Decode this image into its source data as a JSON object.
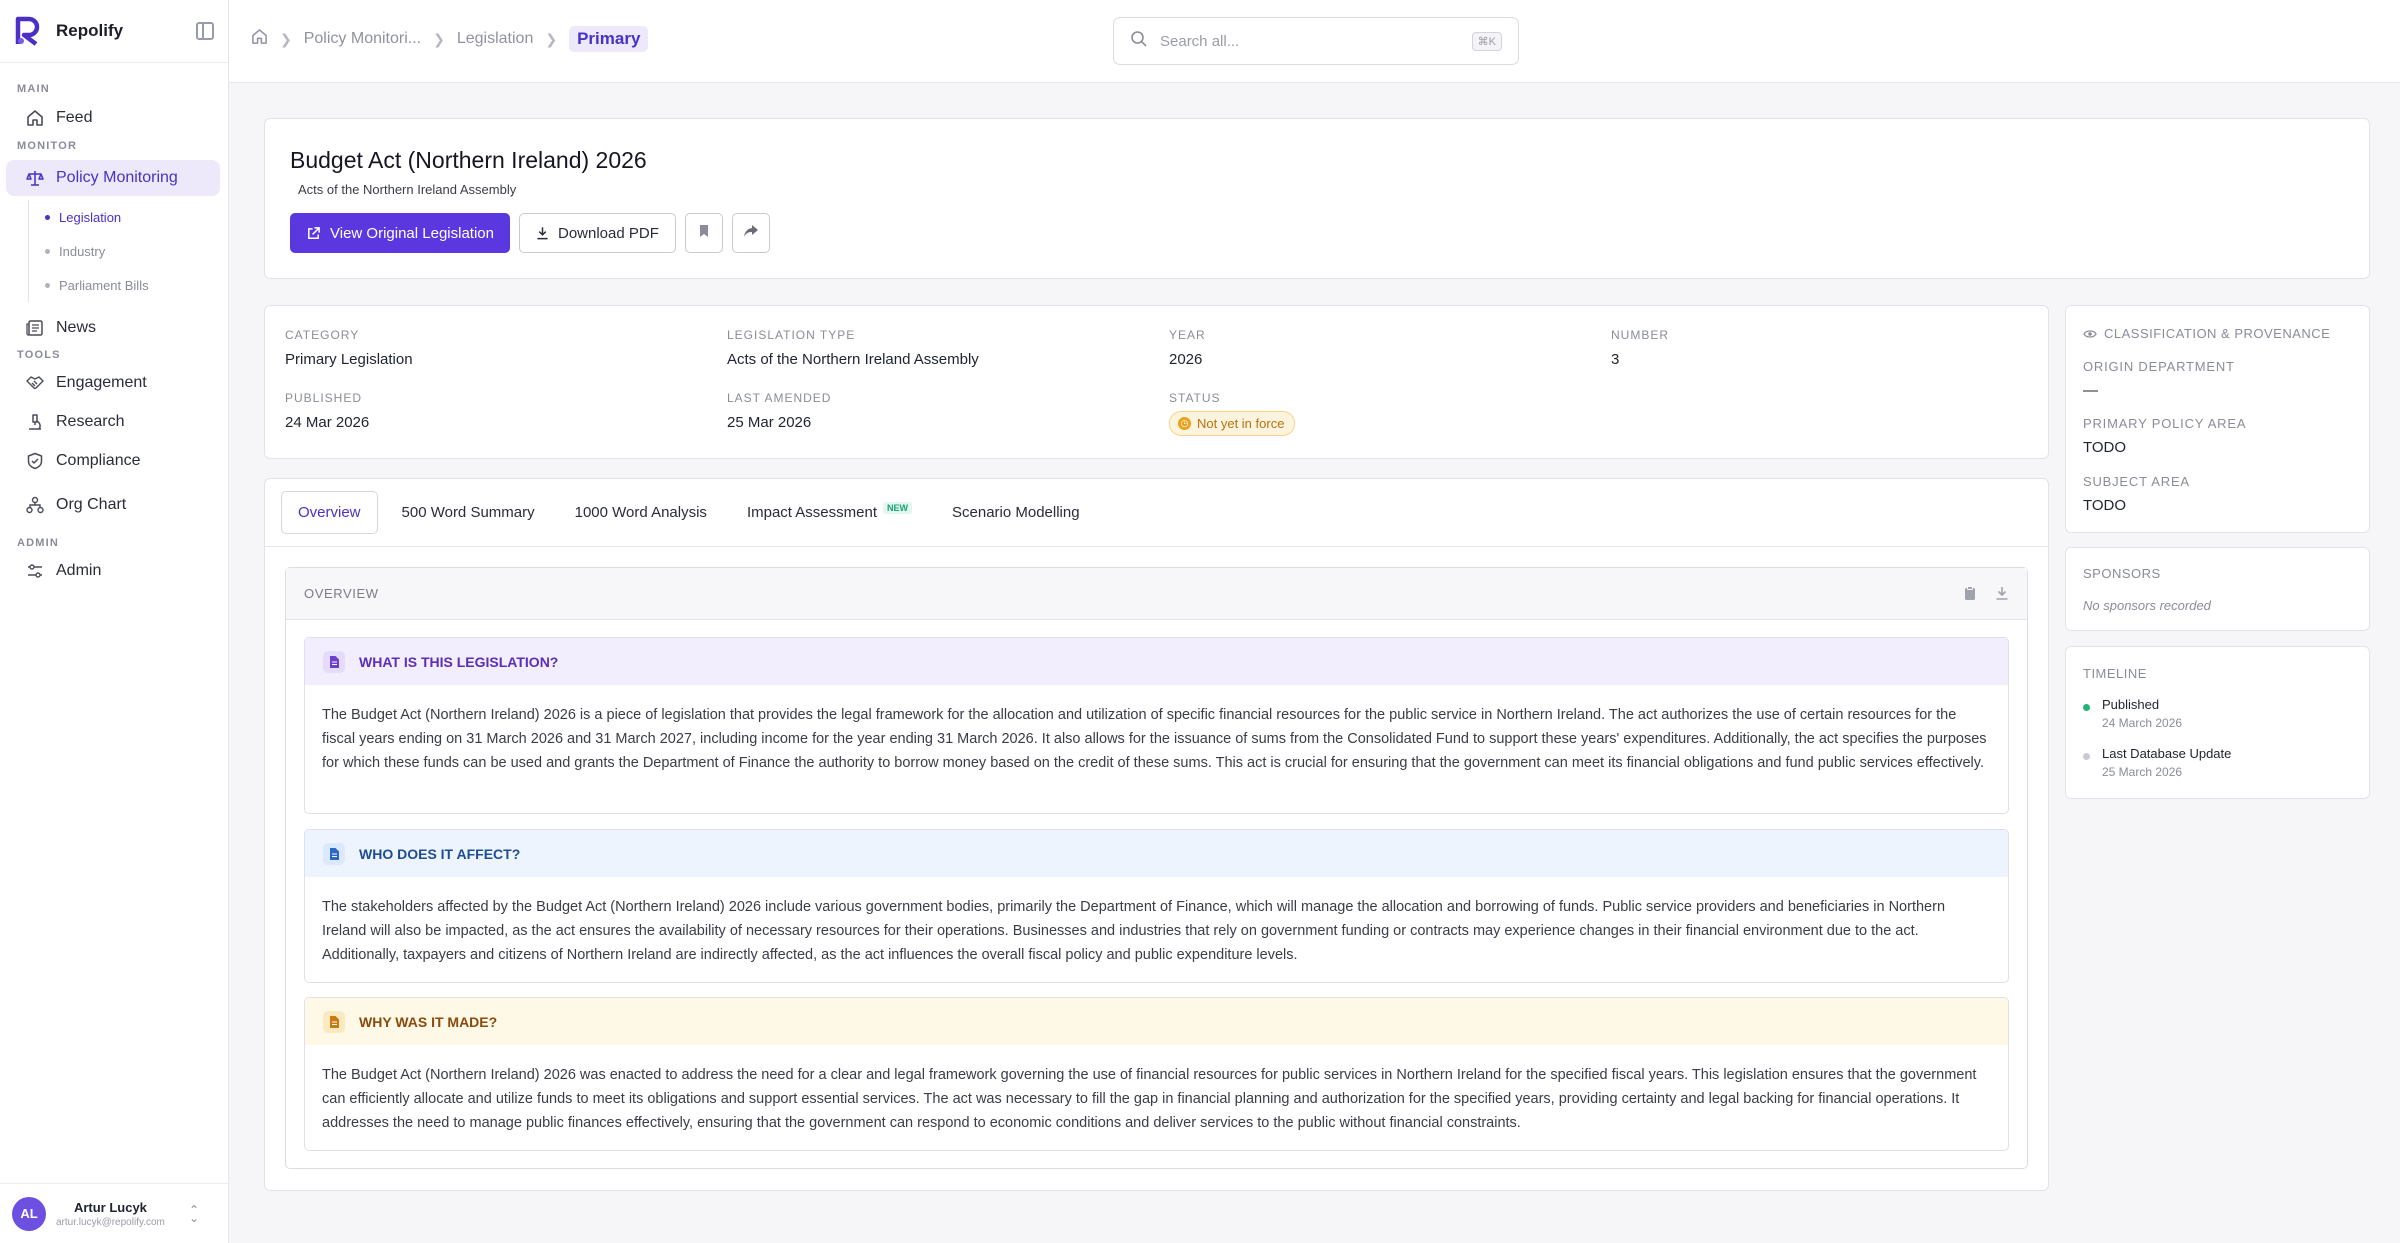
{
  "app": {
    "name": "Repolify"
  },
  "sidebar": {
    "sections": {
      "main": "MAIN",
      "monitor": "MONITOR",
      "tools": "TOOLS",
      "admin": "ADMIN"
    },
    "items": {
      "feed": "Feed",
      "policy_monitoring": "Policy Monitoring",
      "news": "News",
      "engagement": "Engagement",
      "research": "Research",
      "compliance": "Compliance",
      "org_chart": "Org Chart",
      "admin": "Admin"
    },
    "sub_items": {
      "legislation": "Legislation",
      "industry": "Industry",
      "parliament_bills": "Parliament Bills"
    }
  },
  "user": {
    "initials": "AL",
    "name": "Artur Lucyk",
    "email": "artur.lucyk@repolify.com"
  },
  "breadcrumb": {
    "item1": "Policy Monitori...",
    "item2": "Legislation",
    "current": "Primary"
  },
  "search": {
    "placeholder": "Search all...",
    "shortcut": "⌘K"
  },
  "header": {
    "title": "Budget Act (Northern Ireland) 2026",
    "subtitle": "Acts of the Northern Ireland Assembly",
    "view_button": "View Original Legislation",
    "download_button": "Download PDF"
  },
  "meta": {
    "category_label": "CATEGORY",
    "category": "Primary Legislation",
    "type_label": "LEGISLATION TYPE",
    "type": "Acts of the Northern Ireland Assembly",
    "year_label": "YEAR",
    "year": "2026",
    "number_label": "NUMBER",
    "number": "3",
    "published_label": "PUBLISHED",
    "published": "24 Mar 2026",
    "amended_label": "LAST AMENDED",
    "amended": "25 Mar 2026",
    "status_label": "STATUS",
    "status": "Not yet in force"
  },
  "tabs": {
    "overview": "Overview",
    "summary500": "500 Word Summary",
    "analysis1000": "1000 Word Analysis",
    "impact": "Impact Assessment",
    "impact_badge": "NEW",
    "scenario": "Scenario Modelling"
  },
  "overview": {
    "title": "OVERVIEW",
    "what": {
      "heading": "WHAT IS THIS LEGISLATION?",
      "body": "The Budget Act (Northern Ireland) 2026 is a piece of legislation that provides the legal framework for the allocation and utilization of specific financial resources for the public service in Northern Ireland. The act authorizes the use of certain resources for the fiscal years ending on 31 March 2026 and 31 March 2027, including income for the year ending 31 March 2026. It also allows for the issuance of sums from the Consolidated Fund to support these years' expenditures. Additionally, the act specifies the purposes for which these funds can be used and grants the Department of Finance the authority to borrow money based on the credit of these sums. This act is crucial for ensuring that the government can meet its financial obligations and fund public services effectively."
    },
    "who": {
      "heading": "WHO DOES IT AFFECT?",
      "body": "The stakeholders affected by the Budget Act (Northern Ireland) 2026 include various government bodies, primarily the Department of Finance, which will manage the allocation and borrowing of funds. Public service providers and beneficiaries in Northern Ireland will also be impacted, as the act ensures the availability of necessary resources for their operations. Businesses and industries that rely on government funding or contracts may experience changes in their financial environment due to the act. Additionally, taxpayers and citizens of Northern Ireland are indirectly affected, as the act influences the overall fiscal policy and public expenditure levels."
    },
    "why": {
      "heading": "WHY WAS IT MADE?",
      "body": "The Budget Act (Northern Ireland) 2026 was enacted to address the need for a clear and legal framework governing the use of financial resources for public services in Northern Ireland for the specified fiscal years. This legislation ensures that the government can efficiently allocate and utilize funds to meet its obligations and support essential services. The act was necessary to fill the gap in financial planning and authorization for the specified years, providing certainty and legal backing for financial operations. It addresses the need to manage public finances effectively, ensuring that the government can respond to economic conditions and deliver services to the public without financial constraints."
    }
  },
  "classification": {
    "title": "CLASSIFICATION & PROVENANCE",
    "origin_label": "ORIGIN DEPARTMENT",
    "origin": "—",
    "policy_label": "PRIMARY POLICY AREA",
    "policy": "TODO",
    "subject_label": "SUBJECT AREA",
    "subject": "TODO"
  },
  "sponsors": {
    "title": "SPONSORS",
    "empty": "No sponsors recorded"
  },
  "timeline": {
    "title": "TIMELINE",
    "items": [
      {
        "label": "Published",
        "date": "24 March 2026",
        "color": "#22b573"
      },
      {
        "label": "Last Database Update",
        "date": "25 March 2026",
        "color": "#c8c9d2"
      }
    ]
  },
  "colors": {
    "accent": "#5b37e0",
    "status_warning": "#e8a21e"
  }
}
